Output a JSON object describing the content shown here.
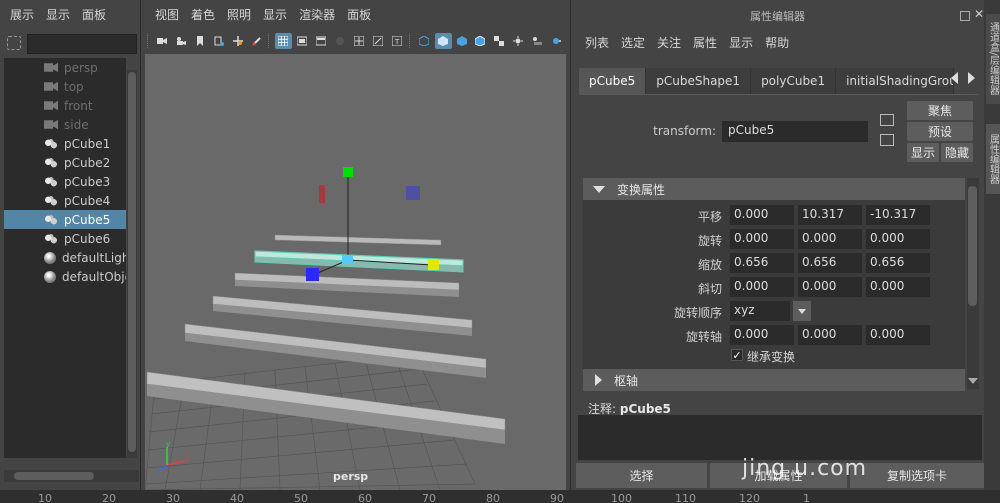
{
  "outliner": {
    "menu": [
      "展示",
      "显示",
      "面板"
    ],
    "filter_value": "",
    "items": [
      {
        "label": "persp",
        "icon": "camera-icon",
        "dim": true,
        "selected": false
      },
      {
        "label": "top",
        "icon": "camera-icon",
        "dim": true,
        "selected": false
      },
      {
        "label": "front",
        "icon": "camera-icon",
        "dim": true,
        "selected": false
      },
      {
        "label": "side",
        "icon": "camera-icon",
        "dim": true,
        "selected": false
      },
      {
        "label": "pCube1",
        "icon": "mesh-icon",
        "dim": false,
        "selected": false
      },
      {
        "label": "pCube2",
        "icon": "mesh-icon",
        "dim": false,
        "selected": false
      },
      {
        "label": "pCube3",
        "icon": "mesh-icon",
        "dim": false,
        "selected": false
      },
      {
        "label": "pCube4",
        "icon": "mesh-icon",
        "dim": false,
        "selected": false
      },
      {
        "label": "pCube5",
        "icon": "mesh-icon",
        "dim": false,
        "selected": true
      },
      {
        "label": "pCube6",
        "icon": "mesh-icon",
        "dim": false,
        "selected": false
      },
      {
        "label": "defaultLigh",
        "icon": "light-set-icon",
        "dim": false,
        "selected": false
      },
      {
        "label": "defaultObje",
        "icon": "object-set-icon",
        "dim": false,
        "selected": false
      }
    ]
  },
  "viewport": {
    "menu": [
      "视图",
      "着色",
      "照明",
      "显示",
      "渲染器",
      "面板"
    ],
    "camera_label": "persp",
    "active_tools": [
      "grid-toggle-icon",
      "xray-icon"
    ],
    "colors": {
      "background": "#696969",
      "selection": "#5ad0b4",
      "handle_x": "#2a2aff",
      "handle_y": "#00e000",
      "handle_z": "#e6e600"
    }
  },
  "attribute_editor": {
    "title": "属性编辑器",
    "menu": [
      "列表",
      "选定",
      "关注",
      "属性",
      "显示",
      "帮助"
    ],
    "tabs": [
      {
        "label": "pCube5",
        "active": true
      },
      {
        "label": "pCubeShape1",
        "active": false
      },
      {
        "label": "polyCube1",
        "active": false
      },
      {
        "label": "initialShadingGroup",
        "active": false
      }
    ],
    "transform_label": "transform:",
    "transform_name": "pCube5",
    "buttons": {
      "focus": "聚焦",
      "preset": "预设",
      "show": "显示",
      "hide": "隐藏"
    },
    "section_transform": "变换属性",
    "section_pivot": "枢轴",
    "rows": {
      "translate": {
        "label": "平移",
        "values": [
          "0.000",
          "10.317",
          "-10.317"
        ]
      },
      "rotate": {
        "label": "旋转",
        "values": [
          "0.000",
          "0.000",
          "0.000"
        ]
      },
      "scale": {
        "label": "缩放",
        "values": [
          "0.656",
          "0.656",
          "0.656"
        ]
      },
      "shear": {
        "label": "斜切",
        "values": [
          "0.000",
          "0.000",
          "0.000"
        ]
      },
      "rotate_order": {
        "label": "旋转顺序",
        "value": "xyz"
      },
      "rotate_axis": {
        "label": "旋转轴",
        "values": [
          "0.000",
          "0.000",
          "0.000"
        ]
      }
    },
    "inherit_transform": {
      "label": "继承变换",
      "checked": true
    },
    "notes_label": "注释:",
    "notes_name": "pCube5",
    "bottom_buttons": {
      "select": "选择",
      "load": "加载属性",
      "copy_tab": "复制选项卡"
    },
    "watermark": "jing  u.com"
  },
  "side_tabs": [
    "通道盒/层编辑器",
    "属性编辑器"
  ],
  "timeline": {
    "ticks": [
      "10",
      "20",
      "30",
      "40",
      "50",
      "60",
      "70",
      "80",
      "90",
      "100",
      "110",
      "120",
      "1"
    ]
  }
}
